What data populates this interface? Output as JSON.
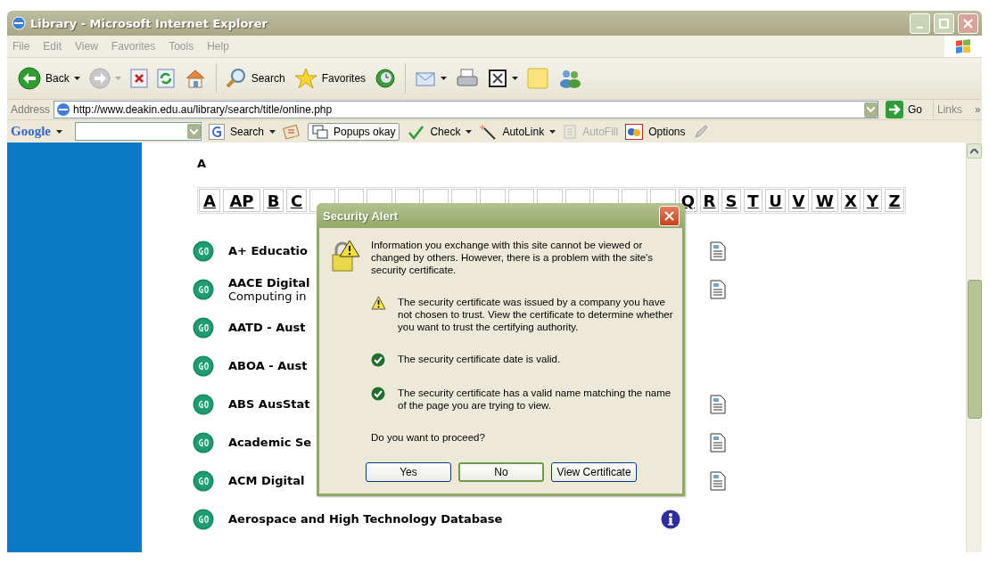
{
  "window": {
    "title": "Library - Microsoft Internet Explorer"
  },
  "menu": [
    "File",
    "Edit",
    "View",
    "Favorites",
    "Tools",
    "Help"
  ],
  "toolbar": [
    {
      "kind": "back",
      "label": "Back",
      "caret": true
    },
    {
      "kind": "forward",
      "caret": true
    },
    {
      "kind": "stop",
      "caret": false
    },
    {
      "kind": "refresh",
      "caret": false
    },
    {
      "kind": "home",
      "caret": false
    },
    {
      "kind": "separator"
    },
    {
      "kind": "search",
      "label": "Search",
      "caret": false
    },
    {
      "kind": "favorites",
      "label": "Favorites",
      "caret": false
    },
    {
      "kind": "history",
      "caret": false
    },
    {
      "kind": "separator"
    },
    {
      "kind": "mail",
      "caret": true
    },
    {
      "kind": "print",
      "caret": false
    },
    {
      "kind": "edit",
      "caret": true
    },
    {
      "kind": "note",
      "caret": false
    },
    {
      "kind": "messenger",
      "caret": false
    }
  ],
  "address": {
    "label": "Address",
    "url": "http://www.deakin.edu.au/library/search/title/online.php",
    "go": "Go",
    "links": "Links",
    "more": "»"
  },
  "google_bar": [
    {
      "kind": "logo",
      "label": "Google",
      "caret": true
    },
    {
      "kind": "field"
    },
    {
      "kind": "search",
      "label": "Search",
      "caret": true
    },
    {
      "kind": "news"
    },
    {
      "kind": "popups",
      "label": "Popups okay",
      "caret": false
    },
    {
      "kind": "check",
      "label": "Check",
      "caret": true
    },
    {
      "kind": "autolink",
      "label": "AutoLink",
      "caret": true
    },
    {
      "kind": "autofill",
      "label": "AutoFill",
      "caret": false,
      "disabled": true
    },
    {
      "kind": "options",
      "label": "Options",
      "caret": false
    },
    {
      "kind": "pencil"
    }
  ],
  "page": {
    "heading": "A",
    "letter_groups": [
      [
        "A",
        "AP",
        "B",
        "C"
      ],
      [
        "Q",
        "R",
        "S",
        "T",
        "U",
        "V",
        "W",
        "X",
        "Y",
        "Z"
      ]
    ],
    "resources": [
      {
        "title": "A+ Educatio",
        "doc": true,
        "info": false
      },
      {
        "title": "AACE Digital",
        "subtitle": "Computing in",
        "doc": true,
        "info": false
      },
      {
        "title": "AATD - Aust",
        "doc": false,
        "info": false
      },
      {
        "title": "ABOA - Aust",
        "doc": false,
        "info": false
      },
      {
        "title": "ABS AusStat",
        "doc": true,
        "info": false
      },
      {
        "title": "Academic Se",
        "doc": true,
        "info": false
      },
      {
        "title": "ACM Digital",
        "doc": true,
        "info": false
      },
      {
        "title": "Aerospace and High Technology Database",
        "doc": false,
        "info": true
      }
    ]
  },
  "dialog": {
    "title": "Security Alert",
    "intro": "Information you exchange with this site cannot be viewed or changed by others. However, there is a problem with the site's security certificate.",
    "checks": [
      {
        "kind": "warning",
        "text": "The security certificate was issued by a company you have not chosen to trust. View the certificate to determine whether you want to trust the certifying authority."
      },
      {
        "kind": "ok",
        "text": "The security certificate date is valid."
      },
      {
        "kind": "ok",
        "text": "The security certificate has a valid name matching the name of the page you are trying to view."
      }
    ],
    "question": "Do you want to proceed?",
    "buttons": [
      {
        "label": "Yes",
        "default": false
      },
      {
        "label": "No",
        "default": true
      },
      {
        "label": "View Certificate",
        "default": false
      }
    ]
  }
}
